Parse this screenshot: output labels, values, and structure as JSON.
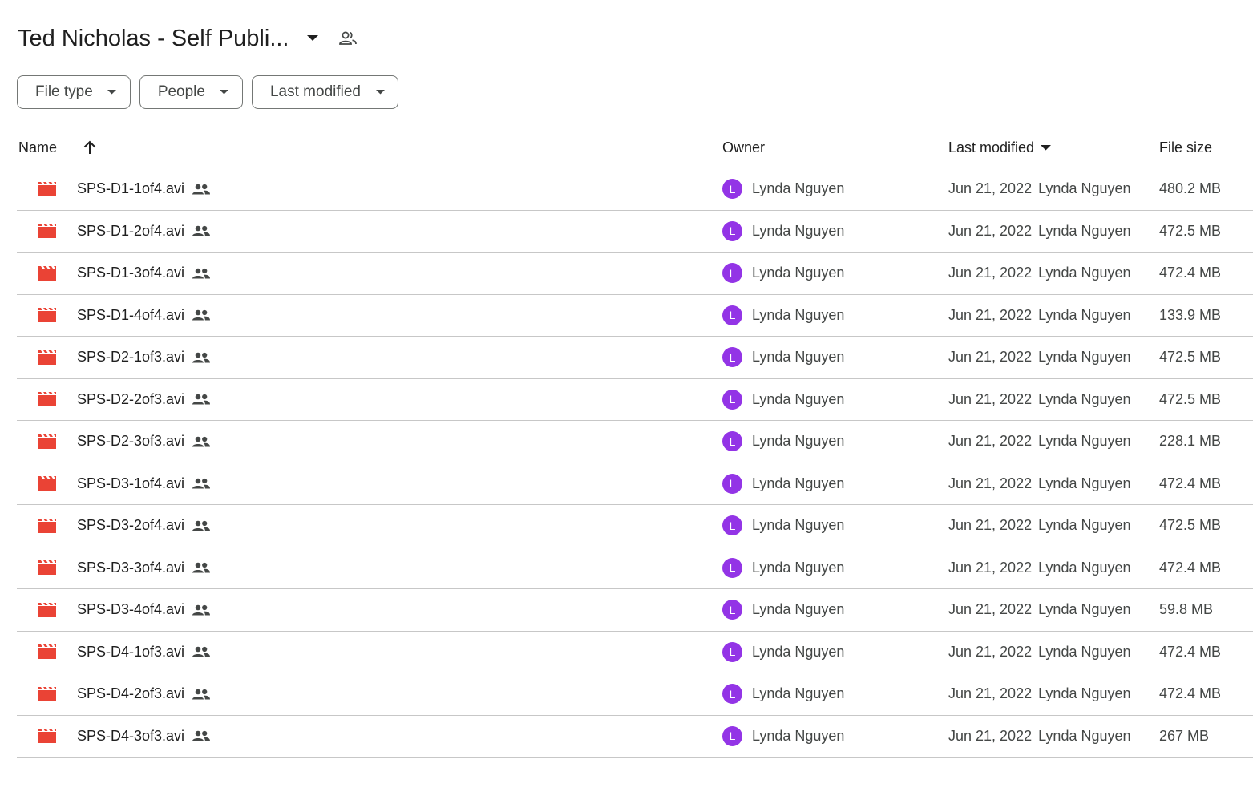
{
  "header": {
    "folder_title": "Ted Nicholas - Self Publi...",
    "caret_icon": "arrow-drop-down-icon",
    "shared_icon": "people-outline-icon"
  },
  "filters": [
    {
      "label": "File type"
    },
    {
      "label": "People"
    },
    {
      "label": "Last modified"
    }
  ],
  "table": {
    "columns": {
      "name": "Name",
      "owner": "Owner",
      "last_modified": "Last modified",
      "file_size": "File size"
    },
    "rows": [
      {
        "name": "SPS-D1-1of4.avi",
        "owner_initial": "L",
        "owner": "Lynda Nguyen",
        "date": "Jun 21, 2022",
        "modified_by": "Lynda Nguyen",
        "size": "480.2 MB"
      },
      {
        "name": "SPS-D1-2of4.avi",
        "owner_initial": "L",
        "owner": "Lynda Nguyen",
        "date": "Jun 21, 2022",
        "modified_by": "Lynda Nguyen",
        "size": "472.5 MB"
      },
      {
        "name": "SPS-D1-3of4.avi",
        "owner_initial": "L",
        "owner": "Lynda Nguyen",
        "date": "Jun 21, 2022",
        "modified_by": "Lynda Nguyen",
        "size": "472.4 MB"
      },
      {
        "name": "SPS-D1-4of4.avi",
        "owner_initial": "L",
        "owner": "Lynda Nguyen",
        "date": "Jun 21, 2022",
        "modified_by": "Lynda Nguyen",
        "size": "133.9 MB"
      },
      {
        "name": "SPS-D2-1of3.avi",
        "owner_initial": "L",
        "owner": "Lynda Nguyen",
        "date": "Jun 21, 2022",
        "modified_by": "Lynda Nguyen",
        "size": "472.5 MB"
      },
      {
        "name": "SPS-D2-2of3.avi",
        "owner_initial": "L",
        "owner": "Lynda Nguyen",
        "date": "Jun 21, 2022",
        "modified_by": "Lynda Nguyen",
        "size": "472.5 MB"
      },
      {
        "name": "SPS-D2-3of3.avi",
        "owner_initial": "L",
        "owner": "Lynda Nguyen",
        "date": "Jun 21, 2022",
        "modified_by": "Lynda Nguyen",
        "size": "228.1 MB"
      },
      {
        "name": "SPS-D3-1of4.avi",
        "owner_initial": "L",
        "owner": "Lynda Nguyen",
        "date": "Jun 21, 2022",
        "modified_by": "Lynda Nguyen",
        "size": "472.4 MB"
      },
      {
        "name": "SPS-D3-2of4.avi",
        "owner_initial": "L",
        "owner": "Lynda Nguyen",
        "date": "Jun 21, 2022",
        "modified_by": "Lynda Nguyen",
        "size": "472.5 MB"
      },
      {
        "name": "SPS-D3-3of4.avi",
        "owner_initial": "L",
        "owner": "Lynda Nguyen",
        "date": "Jun 21, 2022",
        "modified_by": "Lynda Nguyen",
        "size": "472.4 MB"
      },
      {
        "name": "SPS-D3-4of4.avi",
        "owner_initial": "L",
        "owner": "Lynda Nguyen",
        "date": "Jun 21, 2022",
        "modified_by": "Lynda Nguyen",
        "size": "59.8 MB"
      },
      {
        "name": "SPS-D4-1of3.avi",
        "owner_initial": "L",
        "owner": "Lynda Nguyen",
        "date": "Jun 21, 2022",
        "modified_by": "Lynda Nguyen",
        "size": "472.4 MB"
      },
      {
        "name": "SPS-D4-2of3.avi",
        "owner_initial": "L",
        "owner": "Lynda Nguyen",
        "date": "Jun 21, 2022",
        "modified_by": "Lynda Nguyen",
        "size": "472.4 MB"
      },
      {
        "name": "SPS-D4-3of3.avi",
        "owner_initial": "L",
        "owner": "Lynda Nguyen",
        "date": "Jun 21, 2022",
        "modified_by": "Lynda Nguyen",
        "size": "267 MB"
      }
    ]
  },
  "colors": {
    "video_icon": "#ea4335",
    "avatar": "#9334e6",
    "divider": "#c7c7c7",
    "chip_border": "#747775"
  },
  "icons": {
    "file": "video-file-icon",
    "shared": "shared-people-icon",
    "sort": "arrow-upward-icon",
    "dropdown": "arrow-drop-down-icon"
  }
}
